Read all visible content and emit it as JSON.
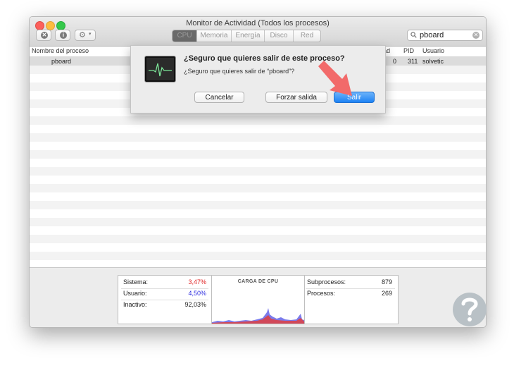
{
  "window": {
    "title": "Monitor de Actividad (Todos los procesos)"
  },
  "toolbar": {
    "tabs": [
      {
        "label": "CPU",
        "active": true
      },
      {
        "label": "Memoria",
        "active": false
      },
      {
        "label": "Energía",
        "active": false
      },
      {
        "label": "Disco",
        "active": false
      },
      {
        "label": "Red",
        "active": false
      }
    ],
    "search_value": "pboard"
  },
  "table": {
    "columns": [
      "Nombre del proceso",
      "ad",
      "PID",
      "Usuario"
    ],
    "rows": [
      {
        "name": "pboard",
        "value": "0",
        "pid": "311",
        "user": "solvetic"
      }
    ]
  },
  "dialog": {
    "title": "¿Seguro que quieres salir de este proceso?",
    "message": "¿Seguro que quieres salir de “pboard”?",
    "buttons": {
      "cancel": "Cancelar",
      "force_quit": "Forzar salida",
      "quit": "Salir"
    }
  },
  "stats": {
    "sistema": {
      "label": "Sistema:",
      "value": "3,47%",
      "color": "#e02020"
    },
    "usuario": {
      "label": "Usuario:",
      "value": "4,50%",
      "color": "#2a2ae0"
    },
    "inactivo": {
      "label": "Inactivo:",
      "value": "92,03%"
    },
    "cpu_load_title": "CARGA DE CPU",
    "subprocesos": {
      "label": "Subprocesos:",
      "value": "879"
    },
    "procesos": {
      "label": "Procesos:",
      "value": "269"
    }
  },
  "colors": {
    "accent": "#1d82f4",
    "arrow": "#f26a6a",
    "logo": "#b9c1c6"
  }
}
